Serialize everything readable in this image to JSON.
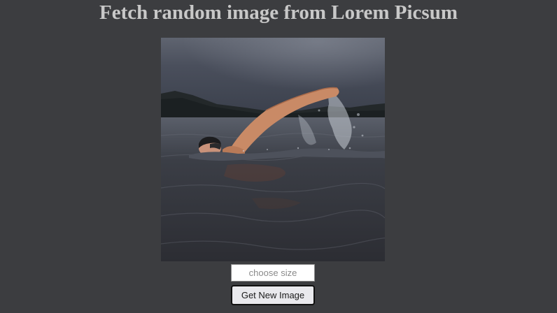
{
  "header": {
    "title": "Fetch random image from Lorem Picsum"
  },
  "image": {
    "icon": "swimmer-photo"
  },
  "controls": {
    "size_input": {
      "value": "",
      "placeholder": "choose size"
    },
    "get_button_label": "Get New Image"
  },
  "colors": {
    "background": "#3c3d40",
    "title": "#c8c8c8"
  }
}
